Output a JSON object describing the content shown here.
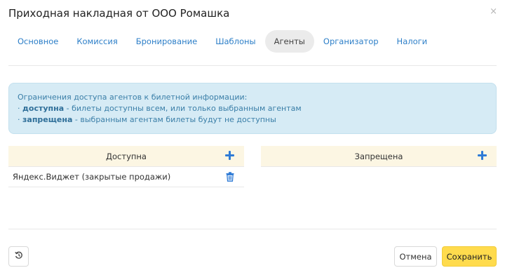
{
  "dialog": {
    "title": "Приходная накладная от ООО Ромашка",
    "close_glyph": "×"
  },
  "tabs": [
    {
      "label": "Основное",
      "active": false
    },
    {
      "label": "Комиссия",
      "active": false
    },
    {
      "label": "Бронирование",
      "active": false
    },
    {
      "label": "Шаблоны",
      "active": false
    },
    {
      "label": "Агенты",
      "active": true
    },
    {
      "label": "Организатор",
      "active": false
    },
    {
      "label": "Налоги",
      "active": false
    }
  ],
  "info": {
    "heading": "Ограничения доступа агентов к билетной информации:",
    "line1_prefix": "· ",
    "line1_bold": "доступна",
    "line1_rest": " - билеты доступны всем, или только выбранным агентам",
    "line2_prefix": "· ",
    "line2_bold": "запрещена",
    "line2_rest": " - выбранным агентам билеты будут не доступны"
  },
  "allowed": {
    "header": "Доступна",
    "add_icon": "plus-icon",
    "rows": [
      {
        "label": "Яндекс.Виджет (закрытые продажи)",
        "action_icon": "trash-icon"
      }
    ]
  },
  "denied": {
    "header": "Запрещена",
    "add_icon": "plus-icon",
    "rows": []
  },
  "footer": {
    "reset_icon": "history-icon",
    "cancel_label": "Отмена",
    "save_label": "Сохранить"
  },
  "colors": {
    "accent_blue": "#2f7bd6",
    "link_blue": "#2d7fc8",
    "save_yellow": "#ffdb4d",
    "info_bg": "#d6ebf5",
    "column_header_bg": "#fcf6e3"
  }
}
